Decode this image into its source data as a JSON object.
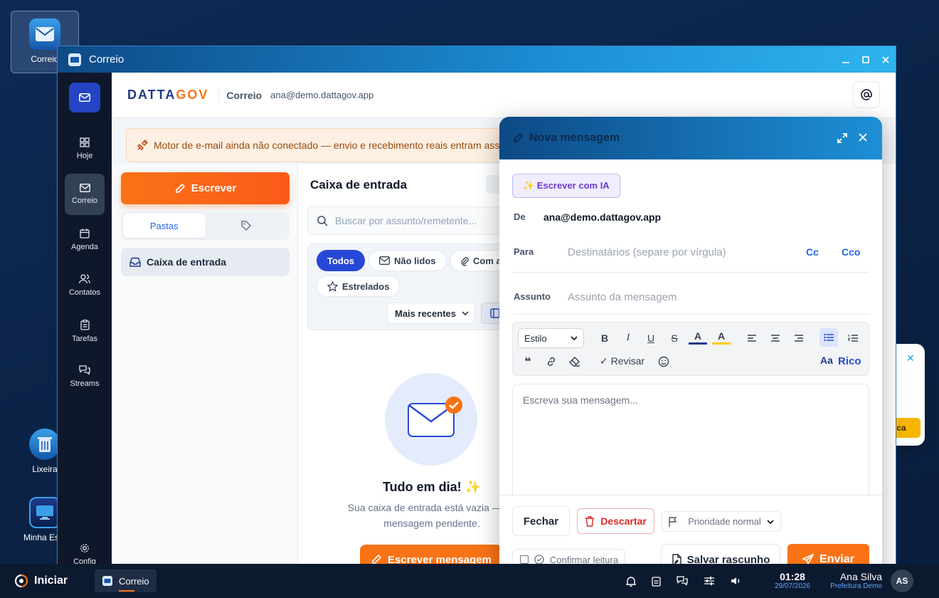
{
  "desktop": {
    "icons": [
      {
        "label": "Correio"
      },
      {
        "label": "Lixeira"
      },
      {
        "label": "Minha Esta"
      }
    ]
  },
  "window": {
    "title": "Correio"
  },
  "rail": {
    "items": [
      {
        "label": "Hoje"
      },
      {
        "label": "Correio"
      },
      {
        "label": "Agenda"
      },
      {
        "label": "Contatos"
      },
      {
        "label": "Tarefas"
      },
      {
        "label": "Streams"
      }
    ],
    "config_label": "Config"
  },
  "header": {
    "brand_part1": "DATTA",
    "brand_part2": "GOV",
    "app": "Correio",
    "account": "ana@demo.dattagov.app"
  },
  "banner": {
    "text": "Motor de e-mail ainda não conectado — envio e recebimento reais entram assi"
  },
  "sidebar": {
    "compose_label": "Escrever",
    "tabs": {
      "folders": "Pastas"
    },
    "folder": "Caixa de entrada"
  },
  "inbox": {
    "title": "Caixa de entrada",
    "search_placeholder": "Buscar por assunto/remetente...",
    "filters": {
      "all": "Todos",
      "unread": "Não lidos",
      "attach": "Com a",
      "starred": "Estrelados"
    },
    "sort": "Mais recentes",
    "empty_title": "Tudo em dia! ✨",
    "empty_sub1": "Sua caixa de entrada está vazia — ne",
    "empty_sub2": "mensagem pendente.",
    "empty_button": "Escrever mensagem"
  },
  "compose": {
    "title": "Nova mensagem",
    "ai_button": "✨ Escrever com IA",
    "from_label": "De",
    "from_value": "ana@demo.dattagov.app",
    "to_label": "Para",
    "to_placeholder": "Destinatários (separe por vírgula)",
    "cc": "Cc",
    "bcc": "Cco",
    "subject_label": "Assunto",
    "subject_placeholder": "Assunto da mensagem",
    "style_select": "Estilo",
    "review": "✓ Revisar",
    "rich_mode": "Rico",
    "font_toggle": "Aa",
    "body_placeholder": "Escreva sua mensagem...",
    "close": "Fechar",
    "discard": "Descartar",
    "priority": "Prioridade normal",
    "read_receipt": "Confirmar leitura",
    "save_draft": "Salvar rascunho",
    "send": "Enviar"
  },
  "toast_partial": {
    "text": "ca"
  },
  "taskbar": {
    "start": "Iniciar",
    "app": "Correio",
    "time": "01:28",
    "date": "29/07/2026",
    "user": "Ana Silva",
    "org": "Prefeitura Demo",
    "initials": "AS"
  },
  "colors": {
    "accent": "#f97316",
    "primary": "#2748d6",
    "titlebar": "#1d8fd6"
  }
}
